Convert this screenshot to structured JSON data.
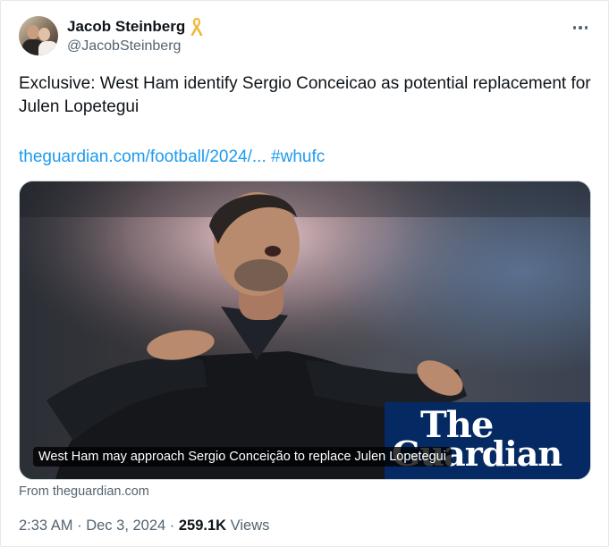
{
  "author": {
    "display_name": "Jacob Steinberg",
    "handle": "@JacobSteinberg",
    "badge_icon": "yellow-ribbon-icon"
  },
  "tweet": {
    "text": "Exclusive: West Ham identify Sergio Conceicao as potential replacement for Julen Lopetegui",
    "link": "theguardian.com/football/2024/...",
    "hashtag": "#whufc"
  },
  "media": {
    "caption": "West Ham may approach Sergio Conceição to replace Julen Lopetegui",
    "logo_line1": "The",
    "logo_line2": "Guardian",
    "source": "From theguardian.com"
  },
  "meta": {
    "time": "2:33 AM",
    "separator": " · ",
    "date": "Dec 3, 2024",
    "views_count": "259.1K",
    "views_label": " Views"
  },
  "colors": {
    "link": "#1d9bf0",
    "secondary_text": "#536471",
    "guardian_blue": "#052962",
    "ribbon": "#f5c542"
  }
}
